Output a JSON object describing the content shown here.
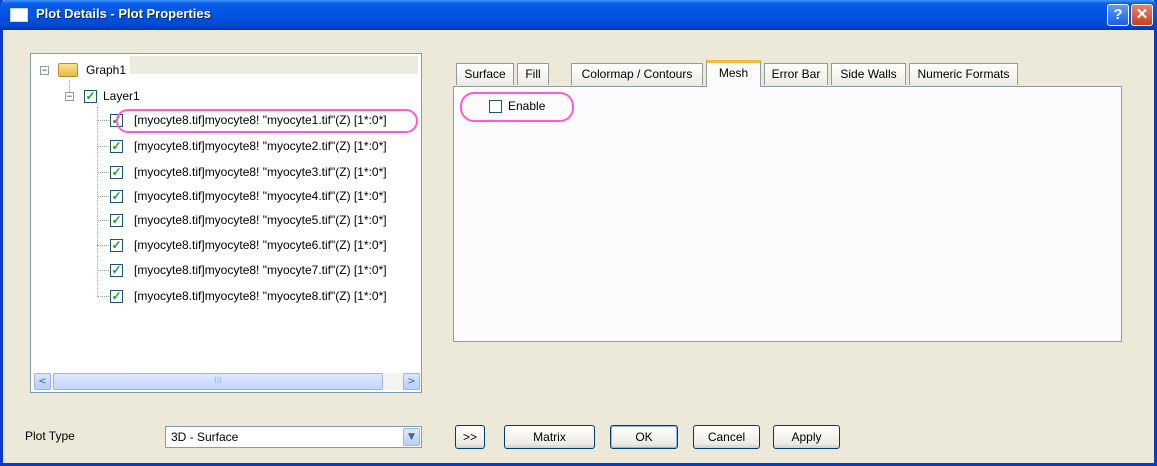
{
  "window": {
    "title": "Plot Details - Plot Properties",
    "help_label": "?",
    "close_label": "✕"
  },
  "tree": {
    "root_label": "Graph1",
    "layer_label": "Layer1",
    "items": [
      "[myocyte8.tif]myocyte8! \"myocyte1.tif\"(Z) [1*:0*]",
      "[myocyte8.tif]myocyte8! \"myocyte2.tif\"(Z) [1*:0*]",
      "[myocyte8.tif]myocyte8! \"myocyte3.tif\"(Z) [1*:0*]",
      "[myocyte8.tif]myocyte8! \"myocyte4.tif\"(Z) [1*:0*]",
      "[myocyte8.tif]myocyte8! \"myocyte5.tif\"(Z) [1*:0*]",
      "[myocyte8.tif]myocyte8! \"myocyte6.tif\"(Z) [1*:0*]",
      "[myocyte8.tif]myocyte8! \"myocyte7.tif\"(Z) [1*:0*]",
      "[myocyte8.tif]myocyte8! \"myocyte8.tif\"(Z) [1*:0*]"
    ],
    "scroll_left": "<",
    "scroll_right": ">",
    "scroll_thumb": "III"
  },
  "tabs": [
    "Surface",
    "Fill",
    "Colormap / Contours",
    "Mesh",
    "Error Bar",
    "Side Walls",
    "Numeric Formats"
  ],
  "active_tab": "Mesh",
  "mesh": {
    "enable_label": "Enable",
    "enable_checked": false
  },
  "plot_type": {
    "label": "Plot Type",
    "value": "3D - Surface",
    "arrow": "▼"
  },
  "buttons": {
    "expand": ">>",
    "matrix": "Matrix",
    "ok": "OK",
    "cancel": "Cancel",
    "apply": "Apply"
  },
  "colors": {
    "titlebar": "#0054e3",
    "dialog_bg": "#ece9d8",
    "highlight_oval": "#ff5ad0",
    "active_tab_accent": "#f7b93b"
  }
}
